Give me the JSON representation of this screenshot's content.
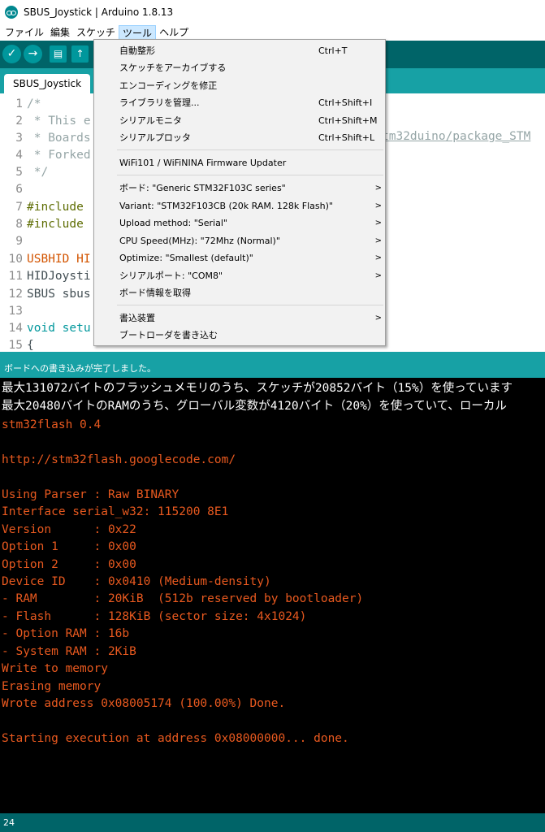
{
  "window": {
    "title": "SBUS_Joystick | Arduino 1.8.13"
  },
  "menubar": {
    "items": [
      "ファイル",
      "編集",
      "スケッチ",
      "ツール",
      "ヘルプ"
    ],
    "active": "ツール"
  },
  "toolbar": {
    "icons": [
      "verify-icon",
      "upload-icon",
      "new-icon",
      "open-icon"
    ],
    "glyphs": [
      "✓",
      "→",
      "▤",
      "↑"
    ]
  },
  "tabs": [
    {
      "label": "SBUS_Joystick"
    }
  ],
  "editor": {
    "lines": [
      {
        "num": "1",
        "text": "/*",
        "style": "comment"
      },
      {
        "num": "2",
        "text": " * This e",
        "style": "comment"
      },
      {
        "num": "3",
        "text": " * Boards",
        "style": "comment"
      },
      {
        "num": "4",
        "text": " * Forked",
        "style": "comment"
      },
      {
        "num": "5",
        "text": " */",
        "style": "comment"
      },
      {
        "num": "6",
        "text": "",
        "style": "normal"
      },
      {
        "num": "7",
        "text": "#include",
        "style": "pre"
      },
      {
        "num": "8",
        "text": "#include",
        "style": "pre"
      },
      {
        "num": "9",
        "text": "",
        "style": "normal"
      },
      {
        "num": "10",
        "text": "USBHID HI",
        "style": "type"
      },
      {
        "num": "11",
        "text": "HIDJoysti",
        "style": "normal"
      },
      {
        "num": "12",
        "text": "SBUS sbus",
        "style": "normal"
      },
      {
        "num": "13",
        "text": "",
        "style": "normal"
      },
      {
        "num": "14",
        "text": "void setu",
        "style": "pre"
      },
      {
        "num": "15",
        "text": "{",
        "style": "normal"
      }
    ],
    "url_fragment": "tm32duino/package_STM"
  },
  "tools_menu": {
    "items": [
      {
        "label": "自動整形",
        "shortcut": "Ctrl+T",
        "submenu": false
      },
      {
        "label": "スケッチをアーカイブする",
        "shortcut": "",
        "submenu": false
      },
      {
        "label": "エンコーディングを修正",
        "shortcut": "",
        "submenu": false
      },
      {
        "label": "ライブラリを管理...",
        "shortcut": "Ctrl+Shift+I",
        "submenu": false
      },
      {
        "label": "シリアルモニタ",
        "shortcut": "Ctrl+Shift+M",
        "submenu": false
      },
      {
        "label": "シリアルプロッタ",
        "shortcut": "Ctrl+Shift+L",
        "submenu": false
      },
      {
        "label": "WiFi101 / WiFiNINA Firmware Updater",
        "shortcut": "",
        "submenu": false
      },
      {
        "label": "ボード: \"Generic STM32F103C series\"",
        "shortcut": "",
        "submenu": true
      },
      {
        "label": "Variant: \"STM32F103CB (20k RAM. 128k Flash)\"",
        "shortcut": "",
        "submenu": true
      },
      {
        "label": "Upload method: \"Serial\"",
        "shortcut": "",
        "submenu": true
      },
      {
        "label": "CPU Speed(MHz): \"72Mhz (Normal)\"",
        "shortcut": "",
        "submenu": true
      },
      {
        "label": "Optimize: \"Smallest (default)\"",
        "shortcut": "",
        "submenu": true
      },
      {
        "label": "シリアルポート: \"COM8\"",
        "shortcut": "",
        "submenu": true
      },
      {
        "label": "ボード情報を取得",
        "shortcut": "",
        "submenu": false
      },
      {
        "label": "書込装置",
        "shortcut": "",
        "submenu": true
      },
      {
        "label": "ブートローダを書き込む",
        "shortcut": "",
        "submenu": false
      }
    ]
  },
  "status": {
    "message": "ボードへの書き込みが完了しました。"
  },
  "console": {
    "lines": [
      {
        "text": "最大131072バイトのフラッシュメモリのうち、スケッチが20852バイト（15%）を使っています",
        "color": "white"
      },
      {
        "text": "最大20480バイトのRAMのうち、グローバル変数が4120バイト（20%）を使っていて、ローカル",
        "color": "white"
      },
      {
        "text": "stm32flash 0.4",
        "color": "orange"
      },
      {
        "text": "",
        "color": "orange"
      },
      {
        "text": "http://stm32flash.googlecode.com/",
        "color": "orange"
      },
      {
        "text": "",
        "color": "orange"
      },
      {
        "text": "Using Parser : Raw BINARY",
        "color": "orange"
      },
      {
        "text": "Interface serial_w32: 115200 8E1",
        "color": "orange"
      },
      {
        "text": "Version      : 0x22",
        "color": "orange"
      },
      {
        "text": "Option 1     : 0x00",
        "color": "orange"
      },
      {
        "text": "Option 2     : 0x00",
        "color": "orange"
      },
      {
        "text": "Device ID    : 0x0410 (Medium-density)",
        "color": "orange"
      },
      {
        "text": "- RAM        : 20KiB  (512b reserved by bootloader)",
        "color": "orange"
      },
      {
        "text": "- Flash      : 128KiB (sector size: 4x1024)",
        "color": "orange"
      },
      {
        "text": "- Option RAM : 16b",
        "color": "orange"
      },
      {
        "text": "- System RAM : 2KiB",
        "color": "orange"
      },
      {
        "text": "Write to memory",
        "color": "orange"
      },
      {
        "text": "Erasing memory",
        "color": "orange"
      },
      {
        "text": "Wrote address 0x08005174 (100.00%) Done.",
        "color": "orange"
      },
      {
        "text": "",
        "color": "orange"
      },
      {
        "text": "Starting execution at address 0x08000000... done.",
        "color": "orange"
      }
    ]
  },
  "bottom": {
    "line_number": "24"
  },
  "colors": {
    "teal_dark": "#006468",
    "teal": "#17a1a5",
    "console_orange": "#e8591f"
  }
}
